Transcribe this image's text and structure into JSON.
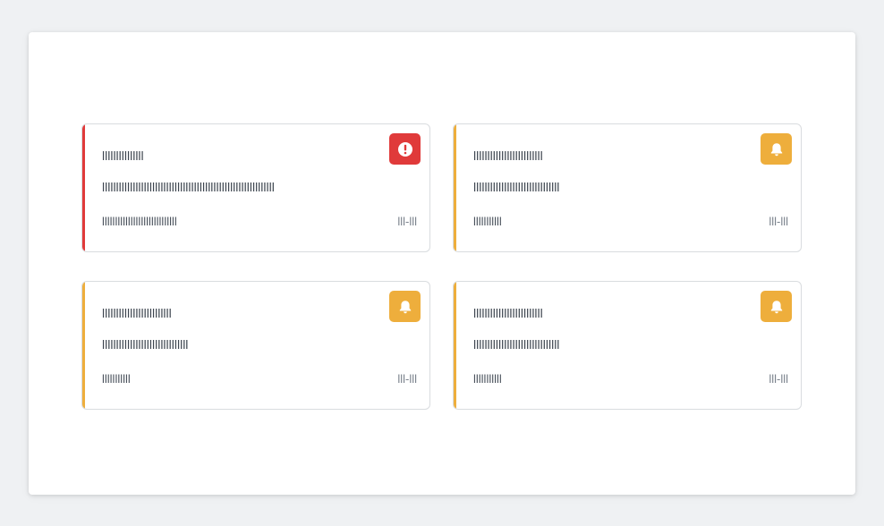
{
  "colors": {
    "critical": "#e03a3a",
    "warning": "#eeae3c"
  },
  "alerts": [
    {
      "severity": "critical",
      "icon": "exclamation-circle-icon",
      "title": "lllllllllllllll",
      "message": "llllllllllllllllllllllllllllllllllllllllllllllllllllllllllllll",
      "meta": "lllllllllllllllllllllllllllll",
      "time": "lll-lll"
    },
    {
      "severity": "warning",
      "icon": "bell-icon",
      "title": "lllllllllllllllllllllllll",
      "message": "lllllllllllllllllllllllllllllll",
      "meta": "lllllllllll",
      "time": "lll-lll"
    },
    {
      "severity": "warning",
      "icon": "bell-icon",
      "title": "lllllllllllllllllllllllll",
      "message": "lllllllllllllllllllllllllllllll",
      "meta": "lllllllllll",
      "time": "lll-lll"
    },
    {
      "severity": "warning",
      "icon": "bell-icon",
      "title": "lllllllllllllllllllllllll",
      "message": "lllllllllllllllllllllllllllllll",
      "meta": "lllllllllll",
      "time": "lll-lll"
    }
  ]
}
